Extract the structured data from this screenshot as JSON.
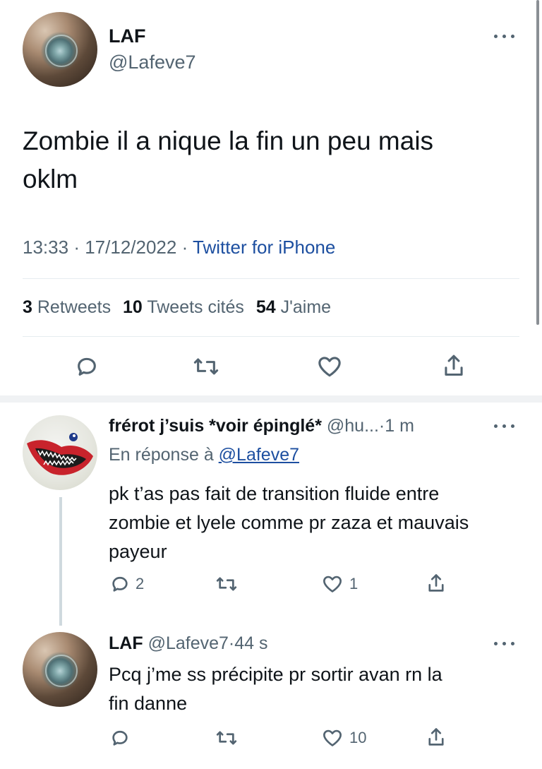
{
  "main_tweet": {
    "author_name": "LAF",
    "author_handle": "@Lafeve7",
    "text_line1": "Zombie il a nique la fin un peu mais",
    "text_line2": "oklm",
    "time": "13:33",
    "sep1": "·",
    "date": "17/12/2022",
    "sep2": "·",
    "source": "Twitter for iPhone",
    "stats": {
      "retweets_count": "3",
      "retweets_label": "Retweets",
      "quotes_count": "10",
      "quotes_label": "Tweets cités",
      "likes_count": "54",
      "likes_label": "J'aime"
    }
  },
  "replies": [
    {
      "author_name": "frérot j’suis *voir épinglé*",
      "author_handle": "@hu...",
      "sep": "·",
      "time": "1 m",
      "replying_prefix": "En réponse à",
      "replying_to": "@Lafeve7",
      "text_line1": "pk t’as pas fait de transition fluide entre",
      "text_line2": "zombie et lyele comme pr zaza et mauvais",
      "text_line3": "payeur",
      "reply_count": "2",
      "retweet_count": "",
      "like_count": "1"
    },
    {
      "author_name": "LAF",
      "author_handle": "@Lafeve7",
      "sep": "·",
      "time": "44 s",
      "text_line1": "Pcq j’me ss précipite pr sortir avan rn la",
      "text_line2": "fin danne",
      "reply_count": "",
      "retweet_count": "",
      "like_count": "10"
    }
  ],
  "icons": [
    "more-icon",
    "reply-icon",
    "retweet-icon",
    "like-icon",
    "share-icon"
  ],
  "colors": {
    "text": "#0f1419",
    "muted": "#536471",
    "link": "#1d4fa0",
    "divider": "#e6ecf0"
  }
}
